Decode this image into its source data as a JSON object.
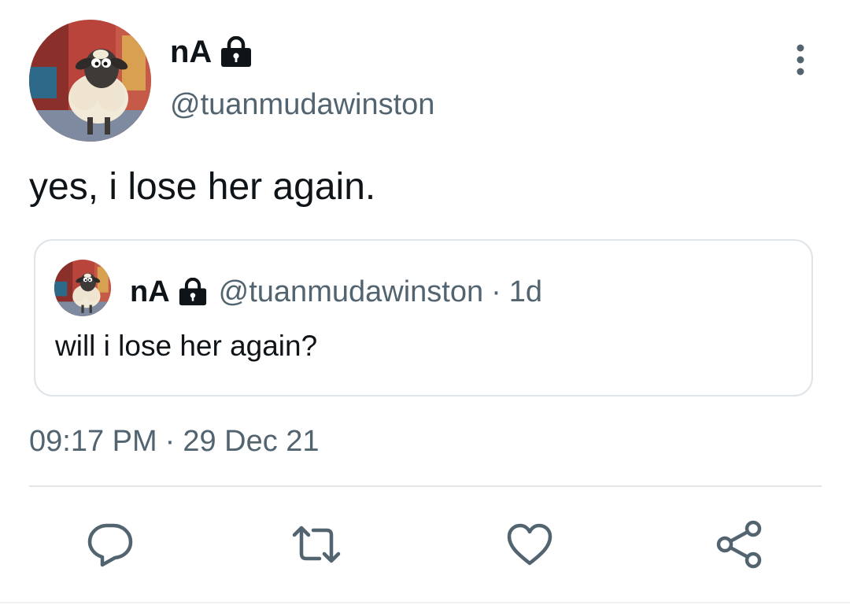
{
  "author": {
    "display_name": "nA",
    "handle": "@tuanmudawinston",
    "protected_icon": "lock-icon",
    "avatar_icon": "sheep-avatar"
  },
  "tweet": {
    "text": "yes, i lose her again.",
    "time": "09:17 PM",
    "date": "29 Dec 21",
    "separator": "·"
  },
  "quoted_tweet": {
    "display_name": "nA",
    "handle": "@tuanmudawinston",
    "separator": "·",
    "age": "1d",
    "text": "will i lose her again?"
  },
  "actions": [
    {
      "name": "reply",
      "icon": "reply-icon"
    },
    {
      "name": "retweet",
      "icon": "retweet-icon"
    },
    {
      "name": "like",
      "icon": "heart-icon"
    },
    {
      "name": "share",
      "icon": "share-icon"
    }
  ],
  "colors": {
    "text": "#0f1419",
    "secondary": "#536471",
    "border": "#dfe4e8",
    "icon": "#536471"
  }
}
